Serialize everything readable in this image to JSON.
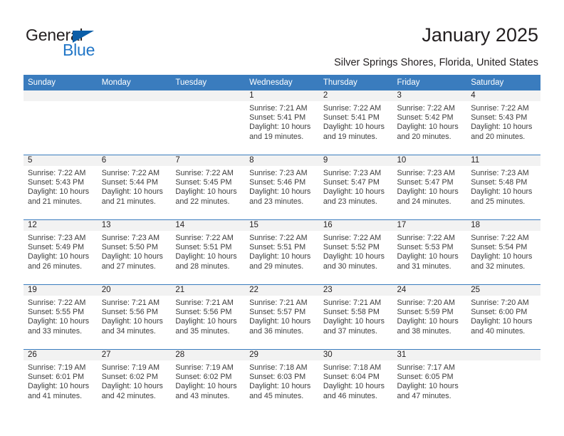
{
  "brand": {
    "name_primary": "General",
    "name_secondary": "Blue"
  },
  "header": {
    "title": "January 2025",
    "location": "Silver Springs Shores, Florida, United States"
  },
  "colors": {
    "header_blue": "#3a7cbe",
    "brand_blue": "#2176c7",
    "flag_blue": "#0b5ea8",
    "daynum_band": "#f2f2f2",
    "text": "#231f20"
  },
  "weekday_headers": [
    "Sunday",
    "Monday",
    "Tuesday",
    "Wednesday",
    "Thursday",
    "Friday",
    "Saturday"
  ],
  "labels": {
    "sunrise_prefix": "Sunrise: ",
    "sunset_prefix": "Sunset: ",
    "daylight_prefix": "Daylight: "
  },
  "weeks": [
    [
      {
        "day": "",
        "sunrise": "",
        "sunset": "",
        "daylight_line1": "",
        "daylight_line2": ""
      },
      {
        "day": "",
        "sunrise": "",
        "sunset": "",
        "daylight_line1": "",
        "daylight_line2": ""
      },
      {
        "day": "",
        "sunrise": "",
        "sunset": "",
        "daylight_line1": "",
        "daylight_line2": ""
      },
      {
        "day": "1",
        "sunrise": "Sunrise: 7:21 AM",
        "sunset": "Sunset: 5:41 PM",
        "daylight_line1": "Daylight: 10 hours",
        "daylight_line2": "and 19 minutes."
      },
      {
        "day": "2",
        "sunrise": "Sunrise: 7:22 AM",
        "sunset": "Sunset: 5:41 PM",
        "daylight_line1": "Daylight: 10 hours",
        "daylight_line2": "and 19 minutes."
      },
      {
        "day": "3",
        "sunrise": "Sunrise: 7:22 AM",
        "sunset": "Sunset: 5:42 PM",
        "daylight_line1": "Daylight: 10 hours",
        "daylight_line2": "and 20 minutes."
      },
      {
        "day": "4",
        "sunrise": "Sunrise: 7:22 AM",
        "sunset": "Sunset: 5:43 PM",
        "daylight_line1": "Daylight: 10 hours",
        "daylight_line2": "and 20 minutes."
      }
    ],
    [
      {
        "day": "5",
        "sunrise": "Sunrise: 7:22 AM",
        "sunset": "Sunset: 5:43 PM",
        "daylight_line1": "Daylight: 10 hours",
        "daylight_line2": "and 21 minutes."
      },
      {
        "day": "6",
        "sunrise": "Sunrise: 7:22 AM",
        "sunset": "Sunset: 5:44 PM",
        "daylight_line1": "Daylight: 10 hours",
        "daylight_line2": "and 21 minutes."
      },
      {
        "day": "7",
        "sunrise": "Sunrise: 7:22 AM",
        "sunset": "Sunset: 5:45 PM",
        "daylight_line1": "Daylight: 10 hours",
        "daylight_line2": "and 22 minutes."
      },
      {
        "day": "8",
        "sunrise": "Sunrise: 7:23 AM",
        "sunset": "Sunset: 5:46 PM",
        "daylight_line1": "Daylight: 10 hours",
        "daylight_line2": "and 23 minutes."
      },
      {
        "day": "9",
        "sunrise": "Sunrise: 7:23 AM",
        "sunset": "Sunset: 5:47 PM",
        "daylight_line1": "Daylight: 10 hours",
        "daylight_line2": "and 23 minutes."
      },
      {
        "day": "10",
        "sunrise": "Sunrise: 7:23 AM",
        "sunset": "Sunset: 5:47 PM",
        "daylight_line1": "Daylight: 10 hours",
        "daylight_line2": "and 24 minutes."
      },
      {
        "day": "11",
        "sunrise": "Sunrise: 7:23 AM",
        "sunset": "Sunset: 5:48 PM",
        "daylight_line1": "Daylight: 10 hours",
        "daylight_line2": "and 25 minutes."
      }
    ],
    [
      {
        "day": "12",
        "sunrise": "Sunrise: 7:23 AM",
        "sunset": "Sunset: 5:49 PM",
        "daylight_line1": "Daylight: 10 hours",
        "daylight_line2": "and 26 minutes."
      },
      {
        "day": "13",
        "sunrise": "Sunrise: 7:23 AM",
        "sunset": "Sunset: 5:50 PM",
        "daylight_line1": "Daylight: 10 hours",
        "daylight_line2": "and 27 minutes."
      },
      {
        "day": "14",
        "sunrise": "Sunrise: 7:22 AM",
        "sunset": "Sunset: 5:51 PM",
        "daylight_line1": "Daylight: 10 hours",
        "daylight_line2": "and 28 minutes."
      },
      {
        "day": "15",
        "sunrise": "Sunrise: 7:22 AM",
        "sunset": "Sunset: 5:51 PM",
        "daylight_line1": "Daylight: 10 hours",
        "daylight_line2": "and 29 minutes."
      },
      {
        "day": "16",
        "sunrise": "Sunrise: 7:22 AM",
        "sunset": "Sunset: 5:52 PM",
        "daylight_line1": "Daylight: 10 hours",
        "daylight_line2": "and 30 minutes."
      },
      {
        "day": "17",
        "sunrise": "Sunrise: 7:22 AM",
        "sunset": "Sunset: 5:53 PM",
        "daylight_line1": "Daylight: 10 hours",
        "daylight_line2": "and 31 minutes."
      },
      {
        "day": "18",
        "sunrise": "Sunrise: 7:22 AM",
        "sunset": "Sunset: 5:54 PM",
        "daylight_line1": "Daylight: 10 hours",
        "daylight_line2": "and 32 minutes."
      }
    ],
    [
      {
        "day": "19",
        "sunrise": "Sunrise: 7:22 AM",
        "sunset": "Sunset: 5:55 PM",
        "daylight_line1": "Daylight: 10 hours",
        "daylight_line2": "and 33 minutes."
      },
      {
        "day": "20",
        "sunrise": "Sunrise: 7:21 AM",
        "sunset": "Sunset: 5:56 PM",
        "daylight_line1": "Daylight: 10 hours",
        "daylight_line2": "and 34 minutes."
      },
      {
        "day": "21",
        "sunrise": "Sunrise: 7:21 AM",
        "sunset": "Sunset: 5:56 PM",
        "daylight_line1": "Daylight: 10 hours",
        "daylight_line2": "and 35 minutes."
      },
      {
        "day": "22",
        "sunrise": "Sunrise: 7:21 AM",
        "sunset": "Sunset: 5:57 PM",
        "daylight_line1": "Daylight: 10 hours",
        "daylight_line2": "and 36 minutes."
      },
      {
        "day": "23",
        "sunrise": "Sunrise: 7:21 AM",
        "sunset": "Sunset: 5:58 PM",
        "daylight_line1": "Daylight: 10 hours",
        "daylight_line2": "and 37 minutes."
      },
      {
        "day": "24",
        "sunrise": "Sunrise: 7:20 AM",
        "sunset": "Sunset: 5:59 PM",
        "daylight_line1": "Daylight: 10 hours",
        "daylight_line2": "and 38 minutes."
      },
      {
        "day": "25",
        "sunrise": "Sunrise: 7:20 AM",
        "sunset": "Sunset: 6:00 PM",
        "daylight_line1": "Daylight: 10 hours",
        "daylight_line2": "and 40 minutes."
      }
    ],
    [
      {
        "day": "26",
        "sunrise": "Sunrise: 7:19 AM",
        "sunset": "Sunset: 6:01 PM",
        "daylight_line1": "Daylight: 10 hours",
        "daylight_line2": "and 41 minutes."
      },
      {
        "day": "27",
        "sunrise": "Sunrise: 7:19 AM",
        "sunset": "Sunset: 6:02 PM",
        "daylight_line1": "Daylight: 10 hours",
        "daylight_line2": "and 42 minutes."
      },
      {
        "day": "28",
        "sunrise": "Sunrise: 7:19 AM",
        "sunset": "Sunset: 6:02 PM",
        "daylight_line1": "Daylight: 10 hours",
        "daylight_line2": "and 43 minutes."
      },
      {
        "day": "29",
        "sunrise": "Sunrise: 7:18 AM",
        "sunset": "Sunset: 6:03 PM",
        "daylight_line1": "Daylight: 10 hours",
        "daylight_line2": "and 45 minutes."
      },
      {
        "day": "30",
        "sunrise": "Sunrise: 7:18 AM",
        "sunset": "Sunset: 6:04 PM",
        "daylight_line1": "Daylight: 10 hours",
        "daylight_line2": "and 46 minutes."
      },
      {
        "day": "31",
        "sunrise": "Sunrise: 7:17 AM",
        "sunset": "Sunset: 6:05 PM",
        "daylight_line1": "Daylight: 10 hours",
        "daylight_line2": "and 47 minutes."
      },
      {
        "day": "",
        "sunrise": "",
        "sunset": "",
        "daylight_line1": "",
        "daylight_line2": ""
      }
    ]
  ]
}
